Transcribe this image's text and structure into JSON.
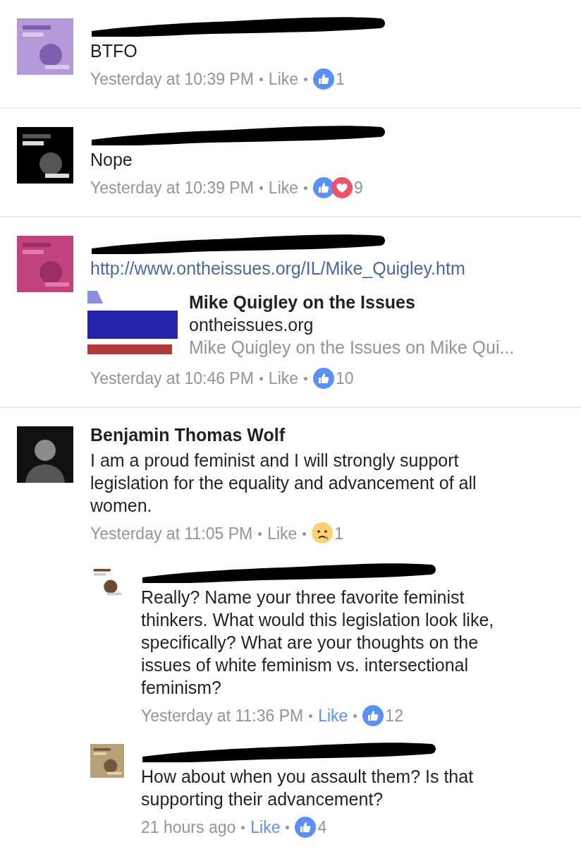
{
  "comments": [
    {
      "redacted": true,
      "avatar": {
        "kind": "picture"
      },
      "text": "BTFO",
      "time": "Yesterday at 10:39 PM",
      "like": {
        "label": "Like",
        "selected": false
      },
      "reactions": [
        {
          "kind": "like"
        }
      ],
      "count": "1"
    },
    {
      "redacted": true,
      "avatar": {
        "kind": "picture"
      },
      "text": "Nope",
      "time": "Yesterday at 10:39 PM",
      "like": {
        "label": "Like",
        "selected": false
      },
      "reactions": [
        {
          "kind": "like"
        },
        {
          "kind": "love"
        }
      ],
      "count": "9"
    },
    {
      "redacted": true,
      "avatar": {
        "kind": "picture"
      },
      "link": "http://www.ontheissues.org/IL/Mike_Quigley.htm",
      "preview": {
        "title": "Mike Quigley on the Issues",
        "domain": "ontheissues.org",
        "description": "Mike Quigley on the Issues on Mike Qui..."
      },
      "time": "Yesterday at 10:46 PM",
      "like": {
        "label": "Like",
        "selected": false
      },
      "reactions": [
        {
          "kind": "like"
        }
      ],
      "count": "10"
    },
    {
      "redacted": false,
      "name": "Benjamin Thomas Wolf",
      "avatar": {
        "kind": "person"
      },
      "text": "I am a proud feminist and I will strongly support legislation for the equality and advancement of all women.",
      "time": "Yesterday at 11:05 PM",
      "like": {
        "label": "Like",
        "selected": false
      },
      "reactions": [
        {
          "kind": "sad"
        }
      ],
      "count": "1",
      "children": [
        {
          "redacted": true,
          "avatar": {
            "kind": "picture"
          },
          "text": "Really? Name your three favorite feminist thinkers. What would this legislation look like, specifically? What are your thoughts on the issues of white feminism vs. intersectional feminism?",
          "time": "Yesterday at 11:36 PM",
          "like": {
            "label": "Like",
            "selected": true
          },
          "reactions": [
            {
              "kind": "like"
            }
          ],
          "count": "12"
        },
        {
          "redacted": true,
          "avatar": {
            "kind": "picture"
          },
          "text": "How about when you assault them? Is that supporting their advancement?",
          "time": "21 hours ago",
          "like": {
            "label": "Like",
            "selected": true
          },
          "reactions": [
            {
              "kind": "like"
            }
          ],
          "count": "4"
        }
      ]
    }
  ]
}
